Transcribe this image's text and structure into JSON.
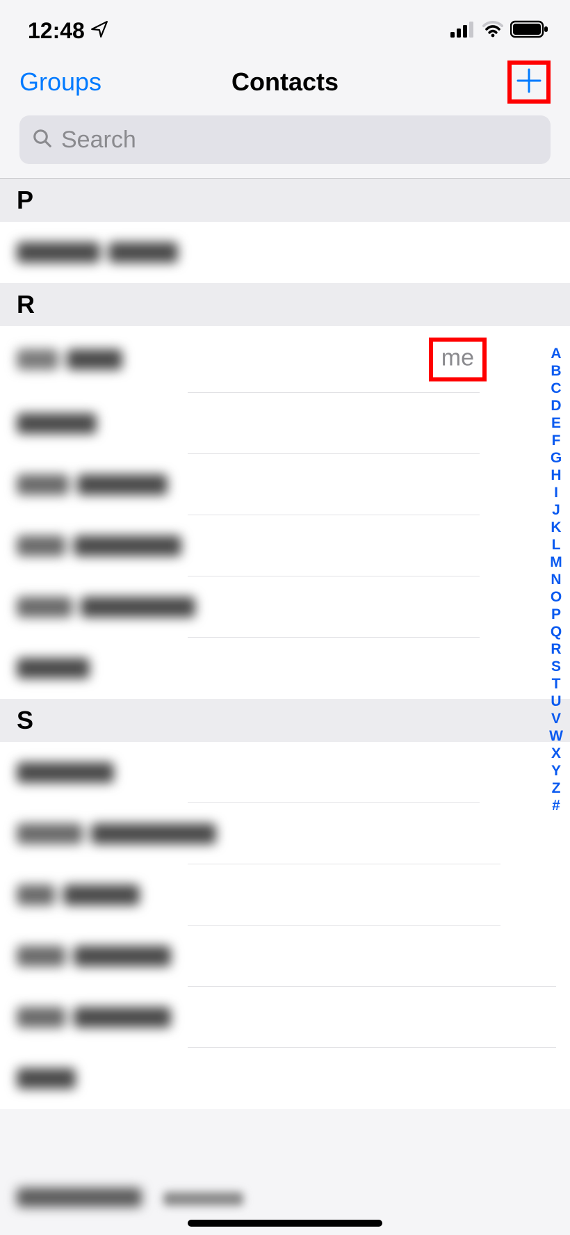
{
  "status": {
    "time": "12:48"
  },
  "nav": {
    "left": "Groups",
    "title": "Contacts"
  },
  "search": {
    "placeholder": "Search"
  },
  "sections": {
    "p": "P",
    "r": "R",
    "s": "S"
  },
  "me_label": "me",
  "index": [
    "A",
    "B",
    "C",
    "D",
    "E",
    "F",
    "G",
    "H",
    "I",
    "J",
    "K",
    "L",
    "M",
    "N",
    "O",
    "P",
    "Q",
    "R",
    "S",
    "T",
    "U",
    "V",
    "W",
    "X",
    "Y",
    "Z",
    "#"
  ]
}
